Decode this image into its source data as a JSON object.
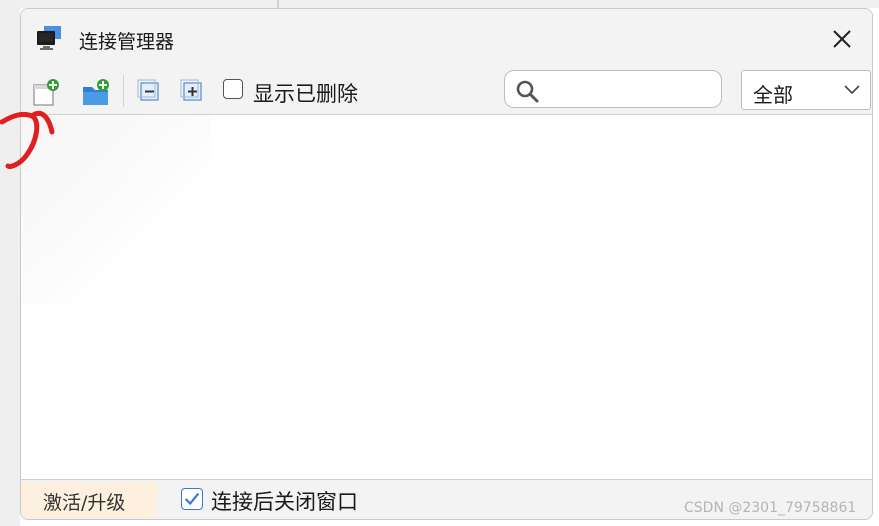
{
  "window": {
    "title": "连接管理器"
  },
  "icons": {
    "app": "monitor-icon",
    "close": "close-icon",
    "new_connection": "new-document-icon",
    "new_folder": "new-folder-icon",
    "collapse_all": "collapse-icon",
    "expand_all": "expand-icon",
    "search": "search-icon",
    "dropdown": "chevron-down-icon"
  },
  "toolbar": {
    "show_deleted_label": "显示已删除",
    "show_deleted_checked": false,
    "search_value": "",
    "filter_value": "全部"
  },
  "footer": {
    "activate_label": "激活/升级",
    "close_after_connect_label": "连接后关闭窗口",
    "close_after_connect_checked": true
  },
  "watermark": {
    "text": "CSDN @2301_79758861"
  },
  "colors": {
    "accent": "#3b76d8",
    "plus_green": "#2fa12f",
    "annotation_red": "#e02020",
    "activate_bg": "#fdf0df"
  }
}
